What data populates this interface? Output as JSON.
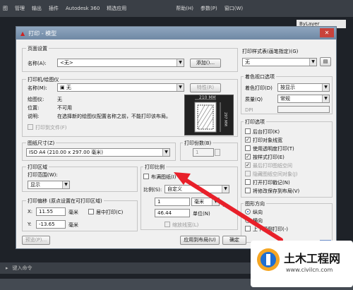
{
  "cad": {
    "menu": [
      "图",
      "管理",
      "输出",
      "插件",
      "Autodesk 360",
      "精选应用"
    ],
    "tabs_right": [
      "帮助(H)",
      "参数(P)",
      "窗口(W)"
    ],
    "bylayer": "ByLayer",
    "command_placeholder": "键入命令"
  },
  "dialog": {
    "title": "打印 - 模型",
    "page_setup": {
      "group": "页面设置",
      "name_label": "名称(A):",
      "name_value": "<无>",
      "add_button": "添加()..."
    },
    "printer": {
      "group": "打印机/绘图仪",
      "name_label": "名称(M):",
      "name_value": "无",
      "properties_button": "特性(R)",
      "plotter_label": "绘图仪:",
      "plotter_value": "无",
      "where_label": "位置:",
      "where_value": "不可用",
      "desc_label": "说明:",
      "desc_value": "在选择新的绘图仪配置名称之前，不能打印该布局。",
      "print_to_file": "打印到文件(F)",
      "paper_dim": "210 MM",
      "paper_dim_v": "297 MM"
    },
    "paper_size": {
      "group": "图纸尺寸(Z)",
      "value": "ISO A4 (210.00 x 297.00 毫米)"
    },
    "copies": {
      "group": "打印份数(B)",
      "value": "1"
    },
    "plot_area": {
      "group": "打印区域",
      "range_label": "打印范围(W):",
      "range_value": "显示"
    },
    "plot_scale": {
      "group": "打印比例",
      "fit_paper": "布满图纸(I)",
      "scale_label": "比例(S):",
      "scale_value": "自定义",
      "num1": "1",
      "unit1": "毫米",
      "num2": "46.44",
      "unit2": "单位(N)",
      "scale_lineweights": "缩放线宽(L)",
      "equals": "="
    },
    "plot_offset": {
      "group": "打印偏移 (原点设置在可打印区域)",
      "x_label": "X:",
      "x_value": "11.55",
      "x_unit": "毫米",
      "center": "居中打印(C)",
      "y_label": "Y:",
      "y_value": "-13.65",
      "y_unit": "毫米"
    },
    "style_table": {
      "group": "打印样式表(画笔指定)(G)",
      "value": "无"
    },
    "shaded": {
      "group": "着色视口选项",
      "shade_label": "着色打印(D)",
      "shade_value": "按显示",
      "quality_label": "质量(Q)",
      "quality_value": "常规",
      "dpi_label": "DPI"
    },
    "options": {
      "group": "打印选项",
      "items": [
        {
          "label": "后台打印(K)",
          "checked": false,
          "disabled": false
        },
        {
          "label": "打印对象线宽",
          "checked": true,
          "disabled": false
        },
        {
          "label": "使用透明度打印(T)",
          "checked": false,
          "disabled": false
        },
        {
          "label": "按样式打印(E)",
          "checked": true,
          "disabled": false
        },
        {
          "label": "最后打印图纸空间",
          "checked": true,
          "disabled": true
        },
        {
          "label": "隐藏图纸空间对象(J)",
          "checked": false,
          "disabled": true
        },
        {
          "label": "打开打印戳记(N)",
          "checked": false,
          "disabled": false
        },
        {
          "label": "将修改保存到布局(V)",
          "checked": false,
          "disabled": false
        }
      ]
    },
    "orientation": {
      "group": "图形方向",
      "portrait": "纵向",
      "landscape": "横向",
      "upside_down": "上下颠倒打印(-)",
      "icon_letter": "A"
    },
    "buttons": {
      "preview": "预览(P)...",
      "apply_layout": "应用到布局(U)",
      "ok": "确定"
    }
  },
  "watermark": {
    "title": "土木工程网",
    "url": "www.civilcn.com"
  },
  "colors": {
    "arrow": "#e8202a",
    "title_bar": "#7f97b3"
  }
}
